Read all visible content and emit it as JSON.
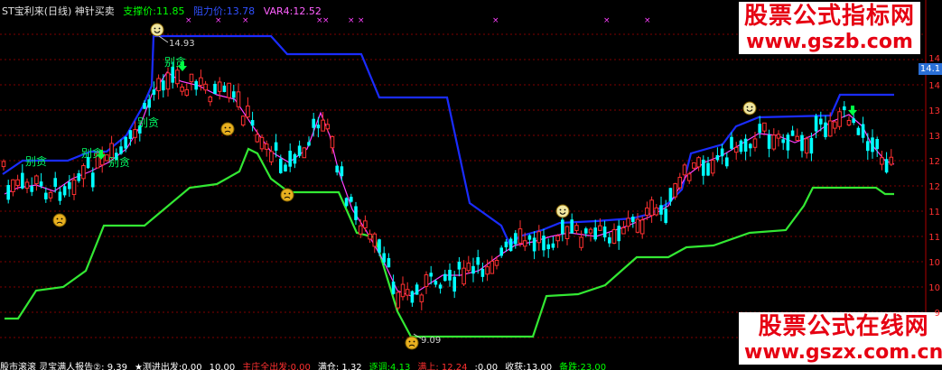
{
  "header": {
    "title": "ST宝利来(日线) 神针买卖",
    "support": "支撑价:11.85",
    "resistance": "阻力价:13.78",
    "var4": "VAR4:12.52",
    "colors": {
      "title": "#e0e0e0",
      "support": "#00ff00",
      "resistance": "#3050ff",
      "var4": "#ff60ff"
    }
  },
  "watermarks": {
    "top_title": "股票公式指标网",
    "top_url": "www.gszb.com",
    "bottom_title": "股票公式在线网",
    "bottom_url": "www.gszx.com.cn"
  },
  "annotations": {
    "high_label": "14.93",
    "low_label": "9.09",
    "bie_tan": "别贪",
    "happy_icon": "smiley-face-icon",
    "sad_icon": "sad-face-icon",
    "arrow_icon": "green-down-arrow-icon"
  },
  "price_axis": {
    "current": "14.1",
    "ticks": [
      "14",
      "14",
      "13",
      "13",
      "12",
      "12",
      "11",
      "11",
      "10",
      "10",
      "9"
    ]
  },
  "footer": {
    "items": [
      {
        "text": "股市滚滚 灵宝满人报告②: 9.39",
        "color": "#ffffff"
      },
      {
        "text": "★测进出发:0.00",
        "color": "#ffffff"
      },
      {
        "text": "10.00",
        "color": "#ffffff"
      },
      {
        "text": "主庄全出发:0.00",
        "color": "#ff3030"
      },
      {
        "text": "满仓: 1.32",
        "color": "#ffffff"
      },
      {
        "text": "逐调:4.13",
        "color": "#00ff00"
      },
      {
        "text": "满上: 12.24",
        "color": "#ff3030"
      },
      {
        "text": ":0.00",
        "color": "#ffffff"
      },
      {
        "text": "收获:13.00",
        "color": "#ffffff"
      },
      {
        "text": "备跌:23.00",
        "color": "#00ff00"
      }
    ]
  }
}
